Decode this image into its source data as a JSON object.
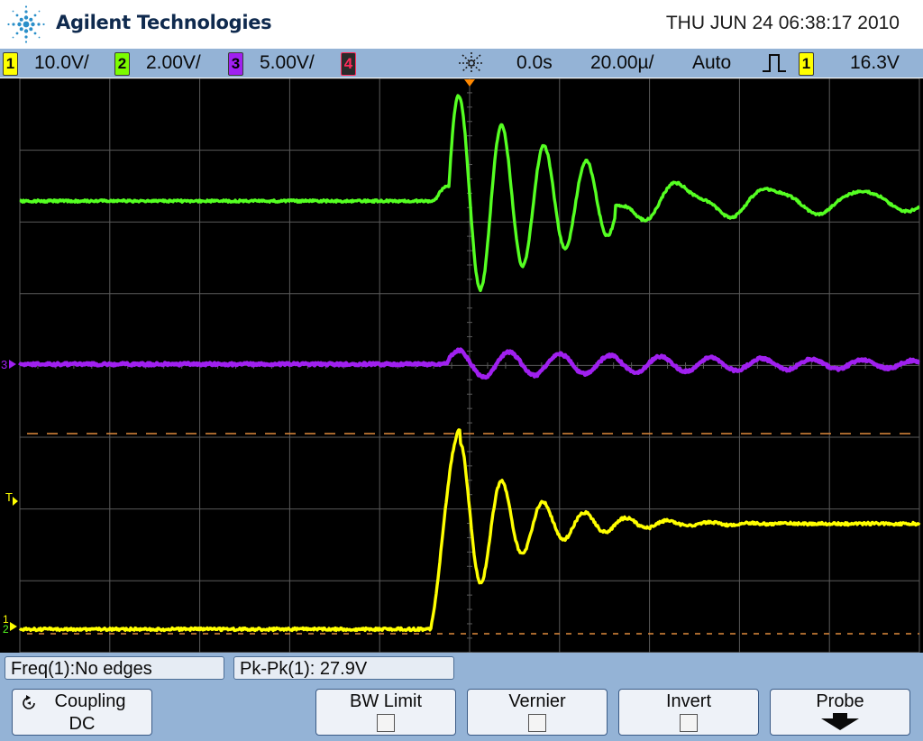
{
  "header": {
    "brand": "Agilent Technologies",
    "datetime": "THU JUN 24 06:38:17 2010"
  },
  "status_bar": {
    "channels": [
      {
        "number": "1",
        "scale": "10.0V/",
        "color": "#ffff00"
      },
      {
        "number": "2",
        "scale": "2.00V/",
        "color": "#7cfc00"
      },
      {
        "number": "3",
        "scale": "5.00V/",
        "color": "#a020f0"
      },
      {
        "number": "4",
        "scale": "",
        "color": "#ff2a5a"
      }
    ],
    "time_delay": "0.0s",
    "time_scale": "20.00µ/",
    "trigger_mode": "Auto",
    "trigger_source": "1",
    "trigger_level": "16.3V"
  },
  "screen": {
    "markers": {
      "trigger": "T",
      "ch3": "3",
      "ch1": "1",
      "ch2": "2"
    },
    "colors": {
      "ch1": "#ffff00",
      "ch2": "#55ff22",
      "ch3": "#a020f0",
      "grid": "#5a5a5a",
      "cursor": "#e08a3c",
      "trigger_marker": "#ff8800"
    }
  },
  "measurements": [
    {
      "text": "Freq(1):No edges"
    },
    {
      "text": "Pk-Pk(1): 27.9V"
    }
  ],
  "softkeys": [
    {
      "label": "Coupling",
      "value": "DC"
    },
    {
      "label": "BW Limit"
    },
    {
      "label": "Vernier"
    },
    {
      "label": "Invert"
    },
    {
      "label": "Probe"
    }
  ]
}
